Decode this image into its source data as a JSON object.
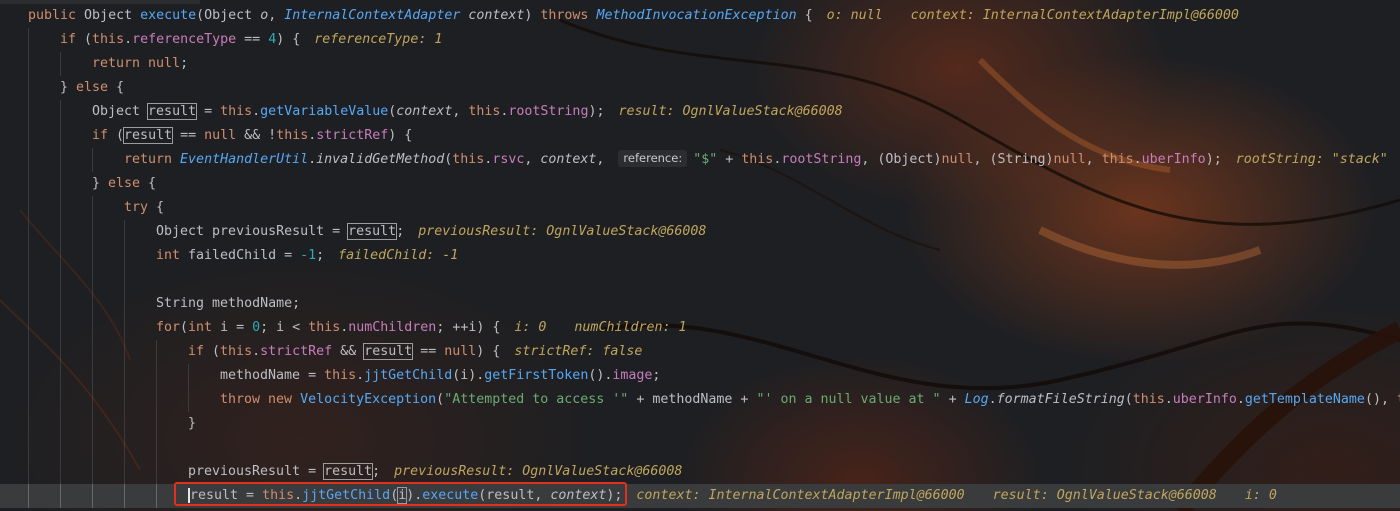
{
  "editor": {
    "lines": [
      {
        "indent": 1,
        "tokens": [
          {
            "t": "public ",
            "c": "kw"
          },
          {
            "t": "Object ",
            "c": "plain"
          },
          {
            "t": "execute",
            "c": "fn"
          },
          {
            "t": "(Object ",
            "c": "plain"
          },
          {
            "t": "o",
            "c": "param"
          },
          {
            "t": ", ",
            "c": "plain"
          },
          {
            "t": "InternalContextAdapter ",
            "c": "type-i"
          },
          {
            "t": "context",
            "c": "param"
          },
          {
            "t": ") ",
            "c": "plain"
          },
          {
            "t": "throws ",
            "c": "kw"
          },
          {
            "t": "MethodInvocationException",
            "c": "type-i"
          },
          {
            "t": " {",
            "c": "plain"
          }
        ],
        "hints": [
          "o: null",
          "context: InternalContextAdapterImpl@66000"
        ]
      },
      {
        "indent": 2,
        "tokens": [
          {
            "t": "if ",
            "c": "kw"
          },
          {
            "t": "(",
            "c": "plain"
          },
          {
            "t": "this",
            "c": "kw"
          },
          {
            "t": ".",
            "c": "plain"
          },
          {
            "t": "referenceType",
            "c": "fld"
          },
          {
            "t": " == ",
            "c": "plain"
          },
          {
            "t": "4",
            "c": "num"
          },
          {
            "t": ") {",
            "c": "plain"
          }
        ],
        "hints": [
          "referenceType: 1"
        ]
      },
      {
        "indent": 3,
        "tokens": [
          {
            "t": "return ",
            "c": "kw"
          },
          {
            "t": "null",
            "c": "kw"
          },
          {
            "t": ";",
            "c": "plain"
          }
        ],
        "hints": []
      },
      {
        "indent": 2,
        "tokens": [
          {
            "t": "} ",
            "c": "plain"
          },
          {
            "t": "else",
            "c": "kw"
          },
          {
            "t": " {",
            "c": "plain"
          }
        ],
        "hints": []
      },
      {
        "indent": 3,
        "tokens": [
          {
            "t": "Object ",
            "c": "plain"
          },
          {
            "t": "result",
            "c": "plain",
            "box": true
          },
          {
            "t": " = ",
            "c": "plain"
          },
          {
            "t": "this",
            "c": "kw"
          },
          {
            "t": ".",
            "c": "plain"
          },
          {
            "t": "getVariableValue",
            "c": "fn"
          },
          {
            "t": "(",
            "c": "plain"
          },
          {
            "t": "context",
            "c": "param"
          },
          {
            "t": ", ",
            "c": "plain"
          },
          {
            "t": "this",
            "c": "kw"
          },
          {
            "t": ".",
            "c": "plain"
          },
          {
            "t": "rootString",
            "c": "fld"
          },
          {
            "t": ");",
            "c": "plain"
          }
        ],
        "hints": [
          "result: OgnlValueStack@66008"
        ]
      },
      {
        "indent": 3,
        "tokens": [
          {
            "t": "if ",
            "c": "kw"
          },
          {
            "t": "(",
            "c": "plain"
          },
          {
            "t": "result",
            "c": "plain",
            "box": true
          },
          {
            "t": " == ",
            "c": "plain"
          },
          {
            "t": "null",
            "c": "kw"
          },
          {
            "t": " && !",
            "c": "plain"
          },
          {
            "t": "this",
            "c": "kw"
          },
          {
            "t": ".",
            "c": "plain"
          },
          {
            "t": "strictRef",
            "c": "fld"
          },
          {
            "t": ") {",
            "c": "plain"
          }
        ],
        "hints": []
      },
      {
        "indent": 4,
        "tokens": [
          {
            "t": "return ",
            "c": "kw"
          },
          {
            "t": "EventHandlerUtil",
            "c": "type-i"
          },
          {
            "t": ".",
            "c": "plain"
          },
          {
            "t": "invalidGetMethod",
            "c": "static"
          },
          {
            "t": "(",
            "c": "plain"
          },
          {
            "t": "this",
            "c": "kw"
          },
          {
            "t": ".",
            "c": "plain"
          },
          {
            "t": "rsvc",
            "c": "fld"
          },
          {
            "t": ", ",
            "c": "plain"
          },
          {
            "t": "context",
            "c": "param"
          },
          {
            "t": ", ",
            "c": "plain"
          },
          {
            "hint": "reference:"
          },
          {
            "t": "\"$\"",
            "c": "str"
          },
          {
            "t": " + ",
            "c": "plain"
          },
          {
            "t": "this",
            "c": "kw"
          },
          {
            "t": ".",
            "c": "plain"
          },
          {
            "t": "rootString",
            "c": "fld"
          },
          {
            "t": ", (Object)",
            "c": "plain"
          },
          {
            "t": "null",
            "c": "kw"
          },
          {
            "t": ", (String)",
            "c": "plain"
          },
          {
            "t": "null",
            "c": "kw"
          },
          {
            "t": ", ",
            "c": "plain"
          },
          {
            "t": "this",
            "c": "kw"
          },
          {
            "t": ".",
            "c": "plain"
          },
          {
            "t": "uberInfo",
            "c": "fld"
          },
          {
            "t": ");",
            "c": "plain"
          }
        ],
        "hints": [
          "rootString: \"stack\""
        ]
      },
      {
        "indent": 3,
        "tokens": [
          {
            "t": "} ",
            "c": "plain"
          },
          {
            "t": "else",
            "c": "kw"
          },
          {
            "t": " {",
            "c": "plain"
          }
        ],
        "hints": []
      },
      {
        "indent": 4,
        "tokens": [
          {
            "t": "try",
            "c": "kw"
          },
          {
            "t": " {",
            "c": "plain"
          }
        ],
        "hints": []
      },
      {
        "indent": 5,
        "tokens": [
          {
            "t": "Object ",
            "c": "plain"
          },
          {
            "t": "previousResult",
            "c": "plain"
          },
          {
            "t": " = ",
            "c": "plain"
          },
          {
            "t": "result",
            "c": "plain",
            "box": true
          },
          {
            "t": ";",
            "c": "plain"
          }
        ],
        "hints": [
          "previousResult: OgnlValueStack@66008"
        ]
      },
      {
        "indent": 5,
        "tokens": [
          {
            "t": "int ",
            "c": "kw"
          },
          {
            "t": "failedChild",
            "c": "plain"
          },
          {
            "t": " = ",
            "c": "plain"
          },
          {
            "t": "-1",
            "c": "num"
          },
          {
            "t": ";",
            "c": "plain"
          }
        ],
        "hints": [
          "failedChild: -1"
        ]
      },
      {
        "indent": 5,
        "tokens": [],
        "hints": []
      },
      {
        "indent": 5,
        "tokens": [
          {
            "t": "String ",
            "c": "plain"
          },
          {
            "t": "methodName",
            "c": "plain"
          },
          {
            "t": ";",
            "c": "plain"
          }
        ],
        "hints": []
      },
      {
        "indent": 5,
        "tokens": [
          {
            "t": "for",
            "c": "kw"
          },
          {
            "t": "(",
            "c": "plain"
          },
          {
            "t": "int ",
            "c": "kw"
          },
          {
            "t": "i",
            "c": "plain"
          },
          {
            "t": " = ",
            "c": "plain"
          },
          {
            "t": "0",
            "c": "num"
          },
          {
            "t": "; ",
            "c": "plain"
          },
          {
            "t": "i",
            "c": "plain"
          },
          {
            "t": " < ",
            "c": "plain"
          },
          {
            "t": "this",
            "c": "kw"
          },
          {
            "t": ".",
            "c": "plain"
          },
          {
            "t": "numChildren",
            "c": "fld"
          },
          {
            "t": "; ++",
            "c": "plain"
          },
          {
            "t": "i",
            "c": "plain"
          },
          {
            "t": ") {",
            "c": "plain"
          }
        ],
        "hints": [
          "i: 0",
          "numChildren: 1"
        ]
      },
      {
        "indent": 6,
        "tokens": [
          {
            "t": "if ",
            "c": "kw"
          },
          {
            "t": "(",
            "c": "plain"
          },
          {
            "t": "this",
            "c": "kw"
          },
          {
            "t": ".",
            "c": "plain"
          },
          {
            "t": "strictRef",
            "c": "fld"
          },
          {
            "t": " && ",
            "c": "plain"
          },
          {
            "t": "result",
            "c": "plain",
            "box": true
          },
          {
            "t": " == ",
            "c": "plain"
          },
          {
            "t": "null",
            "c": "kw"
          },
          {
            "t": ") {",
            "c": "plain"
          }
        ],
        "hints": [
          "strictRef: false"
        ]
      },
      {
        "indent": 7,
        "tokens": [
          {
            "t": "methodName",
            "c": "plain"
          },
          {
            "t": " = ",
            "c": "plain"
          },
          {
            "t": "this",
            "c": "kw"
          },
          {
            "t": ".",
            "c": "plain"
          },
          {
            "t": "jjtGetChild",
            "c": "fn"
          },
          {
            "t": "(",
            "c": "plain"
          },
          {
            "t": "i",
            "c": "plain"
          },
          {
            "t": ").",
            "c": "plain"
          },
          {
            "t": "getFirstToken",
            "c": "fn"
          },
          {
            "t": "().",
            "c": "plain"
          },
          {
            "t": "image",
            "c": "fld"
          },
          {
            "t": ";",
            "c": "plain"
          }
        ],
        "hints": []
      },
      {
        "indent": 7,
        "tokens": [
          {
            "t": "throw ",
            "c": "kw"
          },
          {
            "t": "new ",
            "c": "kw"
          },
          {
            "t": "VelocityException",
            "c": "fn"
          },
          {
            "t": "(",
            "c": "plain"
          },
          {
            "t": "\"Attempted to access '\"",
            "c": "str"
          },
          {
            "t": " + ",
            "c": "plain"
          },
          {
            "t": "methodName",
            "c": "plain"
          },
          {
            "t": " + ",
            "c": "plain"
          },
          {
            "t": "\"' on a null value at \"",
            "c": "str"
          },
          {
            "t": " + ",
            "c": "plain"
          },
          {
            "t": "Log",
            "c": "type-i"
          },
          {
            "t": ".",
            "c": "plain"
          },
          {
            "t": "formatFileString",
            "c": "static"
          },
          {
            "t": "(",
            "c": "plain"
          },
          {
            "t": "this",
            "c": "kw"
          },
          {
            "t": ".",
            "c": "plain"
          },
          {
            "t": "uberInfo",
            "c": "fld"
          },
          {
            "t": ".",
            "c": "plain"
          },
          {
            "t": "getTemplateName",
            "c": "fn"
          },
          {
            "t": "(), ",
            "c": "plain"
          },
          {
            "t": "t",
            "c": "kw"
          }
        ],
        "hints": []
      },
      {
        "indent": 6,
        "tokens": [
          {
            "t": "}",
            "c": "plain"
          }
        ],
        "hints": []
      },
      {
        "indent": 6,
        "tokens": [],
        "hints": []
      },
      {
        "indent": 6,
        "tokens": [
          {
            "t": "previousResult",
            "c": "plain"
          },
          {
            "t": " = ",
            "c": "plain"
          },
          {
            "t": "result",
            "c": "plain",
            "box": true
          },
          {
            "t": ";",
            "c": "plain"
          }
        ],
        "hints": [
          "previousResult: OgnlValueStack@66008"
        ]
      },
      {
        "indent": 6,
        "exec": true,
        "tokens": [
          {
            "t": "result",
            "c": "plain",
            "caret": true
          },
          {
            "t": " = ",
            "c": "plain"
          },
          {
            "t": "this",
            "c": "kw"
          },
          {
            "t": ".",
            "c": "plain"
          },
          {
            "t": "jjtGetChild",
            "c": "fn"
          },
          {
            "t": "(",
            "c": "plain"
          },
          {
            "t": "i",
            "c": "plain",
            "box": true
          },
          {
            "t": ").",
            "c": "plain"
          },
          {
            "t": "execute",
            "c": "fn"
          },
          {
            "t": "(",
            "c": "plain"
          },
          {
            "t": "result",
            "c": "plain"
          },
          {
            "t": ", ",
            "c": "plain"
          },
          {
            "t": "context",
            "c": "param"
          },
          {
            "t": ");",
            "c": "plain"
          }
        ],
        "hints": [
          "context: InternalContextAdapterImpl@66000",
          "result: OgnlValueStack@66008",
          "i: 0"
        ]
      }
    ]
  },
  "colors": {
    "background": "#1e1f22",
    "execution_line": "#3a3b3d",
    "highlight_box": "#e0311c"
  }
}
